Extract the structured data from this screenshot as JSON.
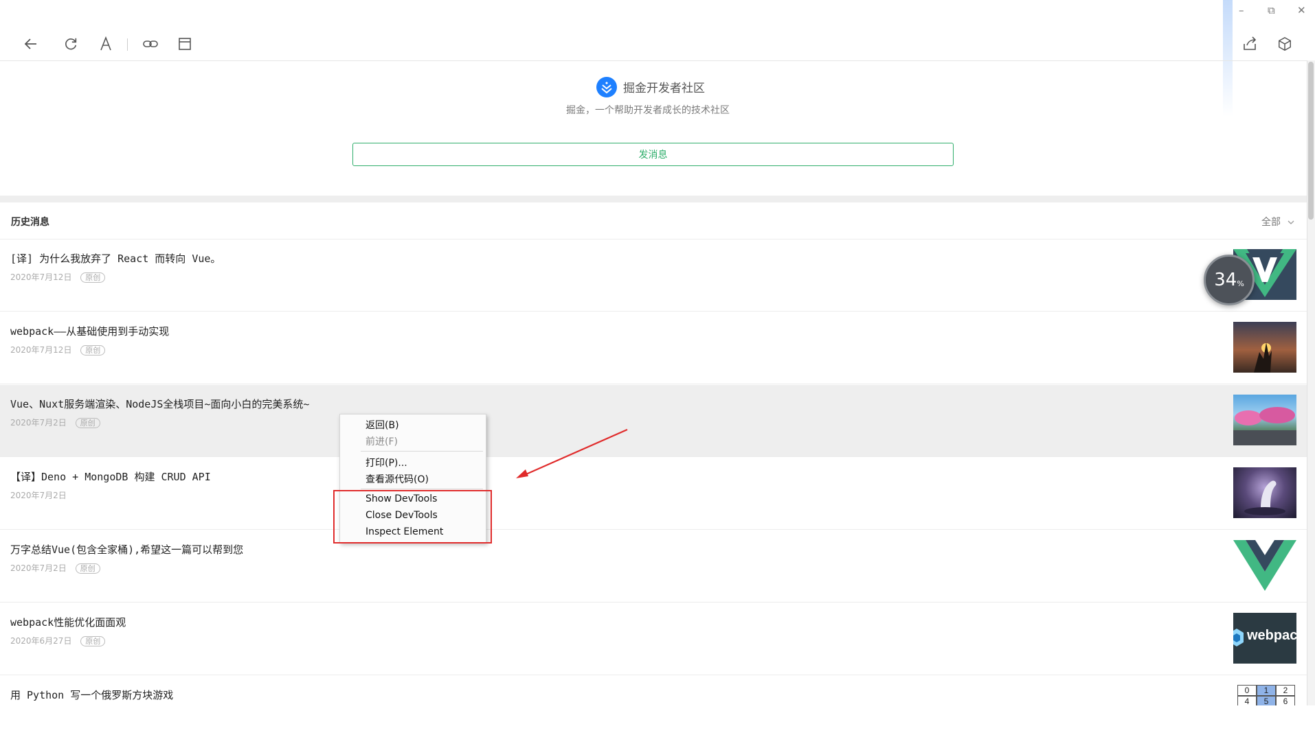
{
  "window": {
    "minimize_glyph": "–",
    "restore_glyph": "⧉",
    "close_glyph": "✕"
  },
  "toolbar": {
    "icons": [
      "back-arrow-icon",
      "refresh-icon",
      "font-icon",
      "link-icon",
      "window-icon",
      "share-icon",
      "cube-icon"
    ]
  },
  "header": {
    "site_title": "掘金开发者社区",
    "subtitle": "掘金，一个帮助开发者成长的技术社区",
    "send_button": "发消息",
    "logo_color": "#1e80ff",
    "accent_color": "#2fae6b"
  },
  "history": {
    "title": "历史消息",
    "filter_label": "全部",
    "articles": [
      {
        "title": "[译] 为什么我放弃了 React 而转向 Vue。",
        "date": "2020年7月12日",
        "badge": "原创",
        "thumb": "vue-logo-thumbnail"
      },
      {
        "title": "webpack——从基础使用到手动实现",
        "date": "2020年7月12日",
        "badge": "原创",
        "thumb": "sunset-hand-thumbnail"
      },
      {
        "title": "Vue、Nuxt服务端渲染、NodeJS全栈项目~面向小白的完美系统~",
        "date": "2020年7月2日",
        "badge": "原创",
        "thumb": "pink-trees-thumbnail"
      },
      {
        "title": "【译】Deno + MongoDB 构建 CRUD API",
        "date": "2020年7月2日",
        "badge": "",
        "thumb": "dinosaur-night-thumbnail"
      },
      {
        "title": "万字总结Vue(包含全家桶),希望这一篇可以帮到您",
        "date": "2020年7月2日",
        "badge": "原创",
        "thumb": "vue-large-logo-thumbnail"
      },
      {
        "title": "webpack性能优化面面观",
        "date": "2020年6月27日",
        "badge": "原创",
        "thumb": "webpack-logo-thumbnail"
      },
      {
        "title": "用 Python 写一个俄罗斯方块游戏",
        "date": "",
        "badge": "",
        "thumb": "grid-numbers-thumbnail"
      }
    ]
  },
  "thumb_text": {
    "webpack": "webpac",
    "grid": [
      "0",
      "1",
      "2",
      "4",
      "5",
      "6"
    ]
  },
  "context_menu": {
    "items": [
      {
        "label": "返回(B)",
        "disabled": false
      },
      {
        "label": "前进(F)",
        "disabled": true
      },
      {
        "label": "打印(P)...",
        "disabled": false
      },
      {
        "label": "查看源代码(O)",
        "disabled": false
      },
      {
        "label": "Show DevTools",
        "disabled": false
      },
      {
        "label": "Close DevTools",
        "disabled": false
      },
      {
        "label": "Inspect Element",
        "disabled": false
      }
    ],
    "highlight_color": "#e02b2b"
  },
  "progress_badge": {
    "value": "34",
    "unit": "%"
  }
}
